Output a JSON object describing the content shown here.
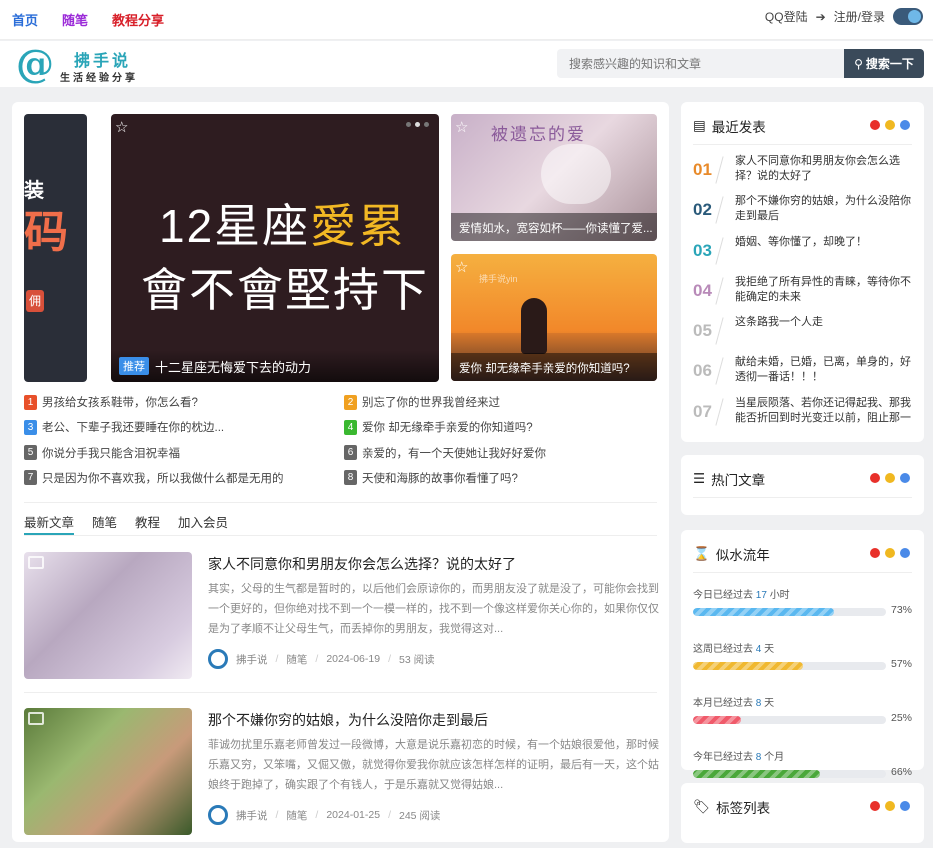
{
  "topnav": {
    "items": [
      "首页",
      "随笔",
      "教程分享"
    ],
    "qq_login": "QQ登陆",
    "register_login": "注册/登录"
  },
  "header": {
    "logo_title": "拂手说",
    "logo_sub": "生活经验分享",
    "search_placeholder": "搜索感兴趣的知识和文章",
    "search_button": "搜索一下"
  },
  "slider": {
    "left_big": "码",
    "left_small": "装",
    "left_btn": "佣",
    "main_line1_a": "12星座",
    "main_line1_b": "愛累",
    "main_line2": "會不會堅持下",
    "main_tag": "推荐",
    "main_caption": "十二星座无悔爱下去的动力",
    "card1_watermark": "被遗忘的爱",
    "card1_caption": "爱情如水，宽容如杯——你读懂了爱...",
    "card2_watermark": "拂手说yin",
    "card2_caption": "爱你 却无缘牵手亲爱的你知道吗?"
  },
  "hot_links": [
    {
      "n": "1",
      "t": "男孩给女孩系鞋带，你怎么看?",
      "c": "#e8502a"
    },
    {
      "n": "2",
      "t": "别忘了你的世界我曾经来过",
      "c": "#f0a020"
    },
    {
      "n": "3",
      "t": "老公、下辈子我还要睡在你的枕边...",
      "c": "#3a8ee8"
    },
    {
      "n": "4",
      "t": "爱你 却无缘牵手亲爱的你知道吗?",
      "c": "#3ab830"
    },
    {
      "n": "5",
      "t": "你说分手我只能含泪祝幸福",
      "c": "#666"
    },
    {
      "n": "6",
      "t": "亲爱的，有一个天使她让我好好爱你",
      "c": "#666"
    },
    {
      "n": "7",
      "t": "只是因为你不喜欢我，所以我做什么都是无用的",
      "c": "#666"
    },
    {
      "n": "8",
      "t": "天使和海豚的故事你看懂了吗?",
      "c": "#666"
    }
  ],
  "tabs": [
    "最新文章",
    "随笔",
    "教程",
    "加入会员"
  ],
  "articles": [
    {
      "title": "家人不同意你和男朋友你会怎么选择？说的太好了",
      "excerpt": "其实，父母的生气都是暂时的，以后他们会原谅你的，而男朋友没了就是没了，可能你会找到一个更好的，但你绝对找不到一个一模一样的，找不到一个像这样爱你关心你的，如果你仅仅是为了孝顺不让父母生气，而丢掉你的男朋友，我觉得这对...",
      "author": "拂手说",
      "cat": "随笔",
      "date": "2024-06-19",
      "reads": "53 阅读"
    },
    {
      "title": "那个不嫌你穷的姑娘，为什么没陪你走到最后",
      "excerpt": "菲诚勿扰里乐嘉老师曾发过一段微博，大意是说乐嘉初恋的时候，有一个姑娘很爱他，那时候乐嘉又穷，又笨嘴，又倔又傲，就觉得你爱我你就应该怎样怎样的证明，最后有一天，这个姑娘终于跑掉了，确实跟了个有钱人，于是乐嘉就又觉得姑娘...",
      "author": "拂手说",
      "cat": "随笔",
      "date": "2024-01-25",
      "reads": "245 阅读"
    }
  ],
  "recent": {
    "title": "最近发表",
    "items": [
      {
        "n": "01",
        "t": "家人不同意你和男朋友你会怎么选择？说的太好了",
        "c": "#e88a2a"
      },
      {
        "n": "02",
        "t": "那个不嫌你穷的姑娘，为什么没陪你走到最后",
        "c": "#2a5a7a"
      },
      {
        "n": "03",
        "t": "婚姻、等你懂了，却晚了！",
        "c": "#2aa5b8"
      },
      {
        "n": "04",
        "t": "我拒绝了所有异性的青睐，等待你不能确定的未来",
        "c": "#b88ab8"
      },
      {
        "n": "05",
        "t": "这条路我一个人走",
        "c": "#bbb"
      },
      {
        "n": "06",
        "t": "献给未婚，已婚，已离，单身的，好透彻一番话！！！",
        "c": "#bbb"
      },
      {
        "n": "07",
        "t": "当星辰陨落、若你还记得起我、那我能否折回到时光变迁以前，阻止那一",
        "c": "#bbb"
      }
    ]
  },
  "hot_articles": {
    "title": "热门文章"
  },
  "time_flow": {
    "title": "似水流年",
    "rows": [
      {
        "pre": "今日已经过去",
        "val": "17",
        "unit": "小时",
        "pct": "73%",
        "fill": 0.73,
        "color": "#5ab8f0"
      },
      {
        "pre": "这周已经过去",
        "val": "4",
        "unit": "天",
        "pct": "57%",
        "fill": 0.57,
        "color": "#f0b830"
      },
      {
        "pre": "本月已经过去",
        "val": "8",
        "unit": "天",
        "pct": "25%",
        "fill": 0.25,
        "color": "#f05a6a"
      },
      {
        "pre": "今年已经过去",
        "val": "8",
        "unit": "个月",
        "pct": "66%",
        "fill": 0.66,
        "color": "#4aa83a"
      }
    ]
  },
  "tags": {
    "title": "标签列表"
  },
  "dot_colors": [
    "#e8302a",
    "#f0b820",
    "#4a8ae8"
  ]
}
